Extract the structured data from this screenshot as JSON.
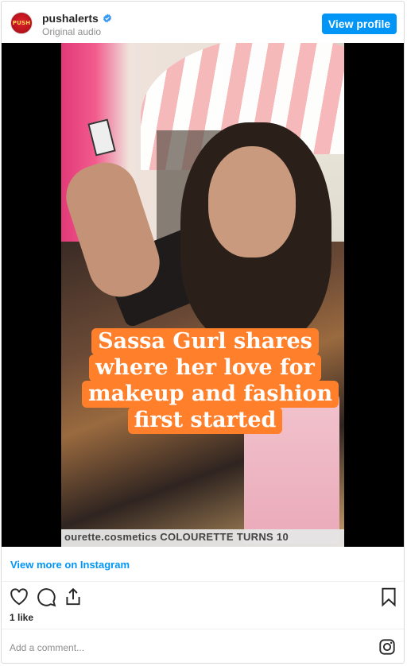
{
  "header": {
    "username": "pushalerts",
    "subtitle": "Original audio",
    "avatar_text": "PUSH",
    "view_profile_label": "View profile"
  },
  "media": {
    "caption_lines": [
      "Sassa Gurl shares",
      "where her love for",
      "makeup and fashion",
      "first started"
    ],
    "ticker_text": "ourette.cosmetics COLOURETTE TURNS 10"
  },
  "view_more_label": "View more on Instagram",
  "likes_text": "1 like",
  "comment": {
    "placeholder": "Add a comment..."
  },
  "colors": {
    "accent": "#0095f6",
    "caption_bg": "#ff7f2a"
  },
  "icons": [
    "verified-badge-icon",
    "heart-icon",
    "comment-icon",
    "share-icon",
    "bookmark-icon",
    "instagram-icon"
  ]
}
